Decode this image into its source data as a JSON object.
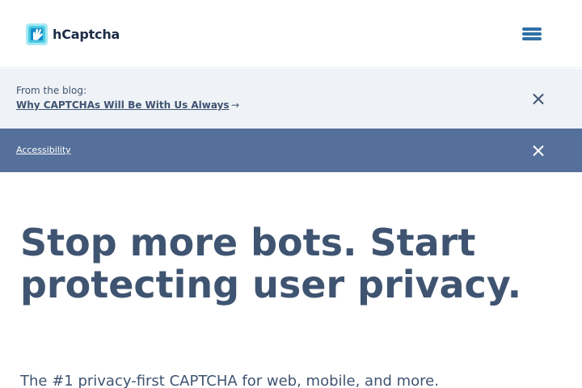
{
  "header": {
    "logo_text": "hCaptcha",
    "menu_icon": "hamburger-icon",
    "logo_icon": "hcaptcha-hand-icon",
    "brand_colors": [
      "#0074bf",
      "#00bfe1",
      "#1d2d45"
    ]
  },
  "blog_banner": {
    "prefix": "From the blog:",
    "link_text": "Why CAPTCHAs Will Be With Us Always",
    "arrow": "→",
    "close_icon": "close-icon"
  },
  "accessibility_banner": {
    "link_text": "Accessibility",
    "close_icon": "close-icon",
    "background": "#55709a"
  },
  "hero": {
    "title": "Stop more bots. Start protecting user privacy.",
    "subtitle": "The #1 privacy-first CAPTCHA for web, mobile, and more."
  }
}
